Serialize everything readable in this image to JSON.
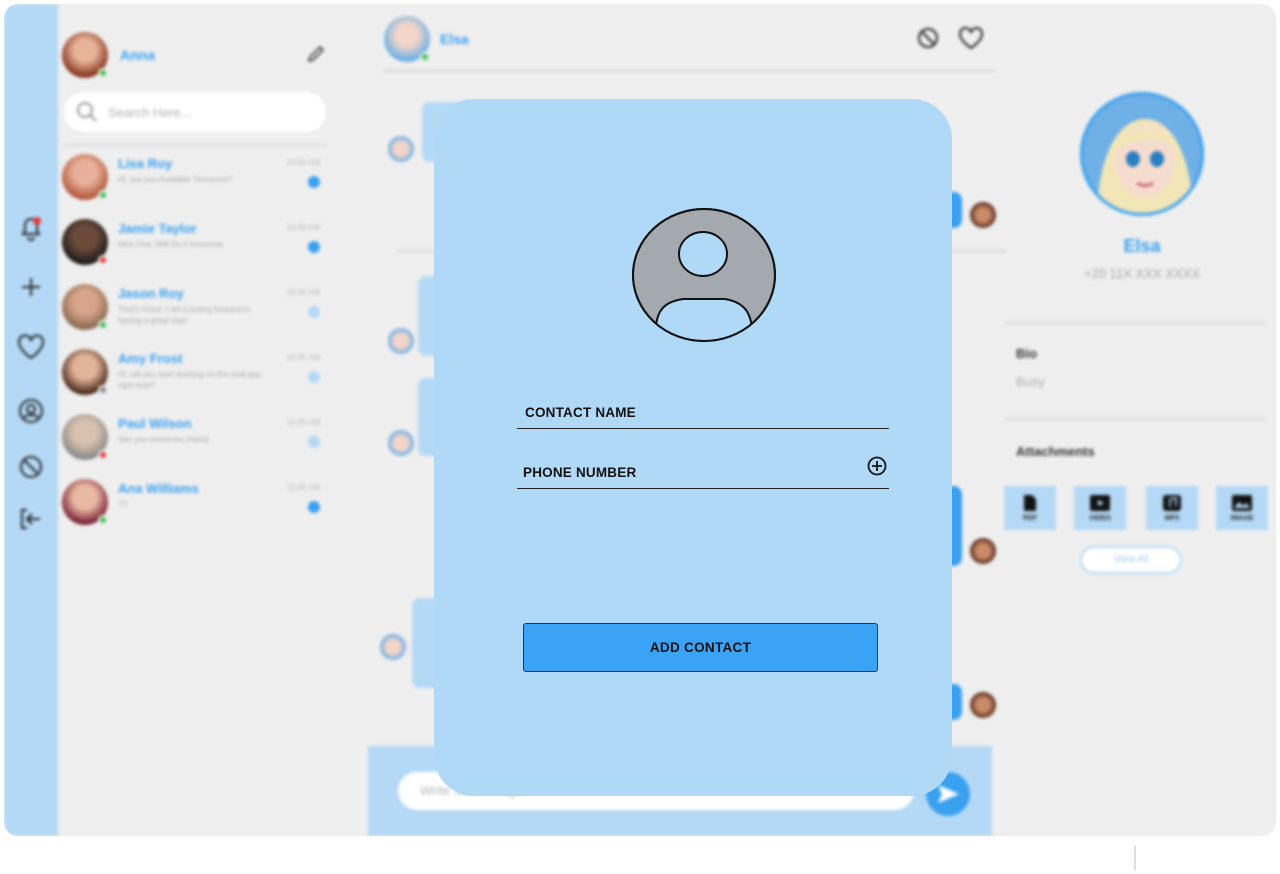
{
  "colors": {
    "accent": "#3aa0f0",
    "light_blue": "#b4d9f6",
    "modal_bg": "#b0d9f8",
    "online": "#3fbf4f",
    "busy": "#e53935"
  },
  "user": {
    "name": "Anna"
  },
  "search": {
    "placeholder": "Search Here..."
  },
  "chats": [
    {
      "name": "Lisa Roy",
      "message": "Hi, are you Available Tomorrow?",
      "time": "10:35 AM",
      "status": "online",
      "unread": true
    },
    {
      "name": "Jamie Taylor",
      "message": "Nice One. Will Do it tomorrow",
      "time": "10:35 AM",
      "status": "busy",
      "unread": true
    },
    {
      "name": "Jason Roy",
      "message": "That's Great. I am Looking forward to having a great start.",
      "time": "10:35 AM",
      "status": "online",
      "unread": false
    },
    {
      "name": "Amy Frost",
      "message": "Hi, will you start working on the chat app right now?",
      "time": "10:35 AM",
      "status": "away",
      "unread": false
    },
    {
      "name": "Paul Wilson",
      "message": "See you tomorrow champ",
      "time": "10:35 AM",
      "status": "busy",
      "unread": false
    },
    {
      "name": "Ana Williams",
      "message": "??",
      "time": "10:35 AM",
      "status": "online",
      "unread": true
    }
  ],
  "conversation": {
    "contact_name": "Elsa",
    "composer_placeholder": "Write Something..."
  },
  "profile": {
    "name": "Elsa",
    "phone": "+20 11X XXX XXXX",
    "bio_label": "Bio",
    "bio": "Busy",
    "attachments_label": "Attachments",
    "attachments": [
      "PDF",
      "VIDEO",
      "MP3",
      "IMAGE"
    ],
    "view_all": "View All"
  },
  "modal": {
    "contact_name_placeholder": "CONTACT NAME",
    "phone_placeholder": "PHONE NUMBER",
    "add_button": "ADD CONTACT"
  }
}
